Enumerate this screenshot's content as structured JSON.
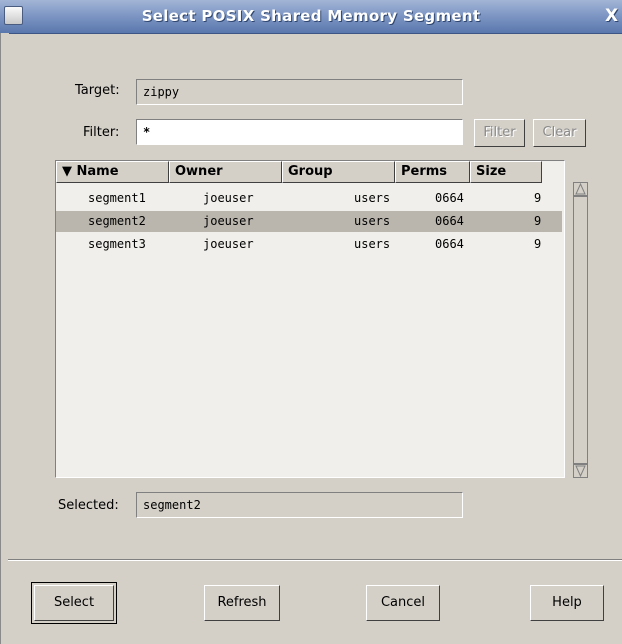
{
  "window": {
    "title": "Select POSIX Shared Memory Segment",
    "close_glyph": "X"
  },
  "target": {
    "label": "Target:",
    "value": "zippy"
  },
  "filter": {
    "label": "Filter:",
    "value": "*",
    "filter_button": "Filter",
    "clear_button": "Clear"
  },
  "table": {
    "sort_indicator": "▼",
    "columns": [
      "Name",
      "Owner",
      "Group",
      "Perms",
      "Size"
    ],
    "rows": [
      {
        "name": "segment1",
        "owner": "joeuser",
        "group": "users",
        "perms": "0664",
        "size": "9",
        "selected": false
      },
      {
        "name": "segment2",
        "owner": "joeuser",
        "group": "users",
        "perms": "0664",
        "size": "9",
        "selected": true
      },
      {
        "name": "segment3",
        "owner": "joeuser",
        "group": "users",
        "perms": "0664",
        "size": "9",
        "selected": false
      }
    ]
  },
  "selected": {
    "label": "Selected:",
    "value": "segment2"
  },
  "buttons": {
    "select": "Select",
    "refresh": "Refresh",
    "cancel": "Cancel",
    "help": "Help"
  },
  "colors": {
    "title_bar": "#7e97c4",
    "dialog_bg": "#d4d0c8",
    "selected_row": "#bab6ae"
  }
}
